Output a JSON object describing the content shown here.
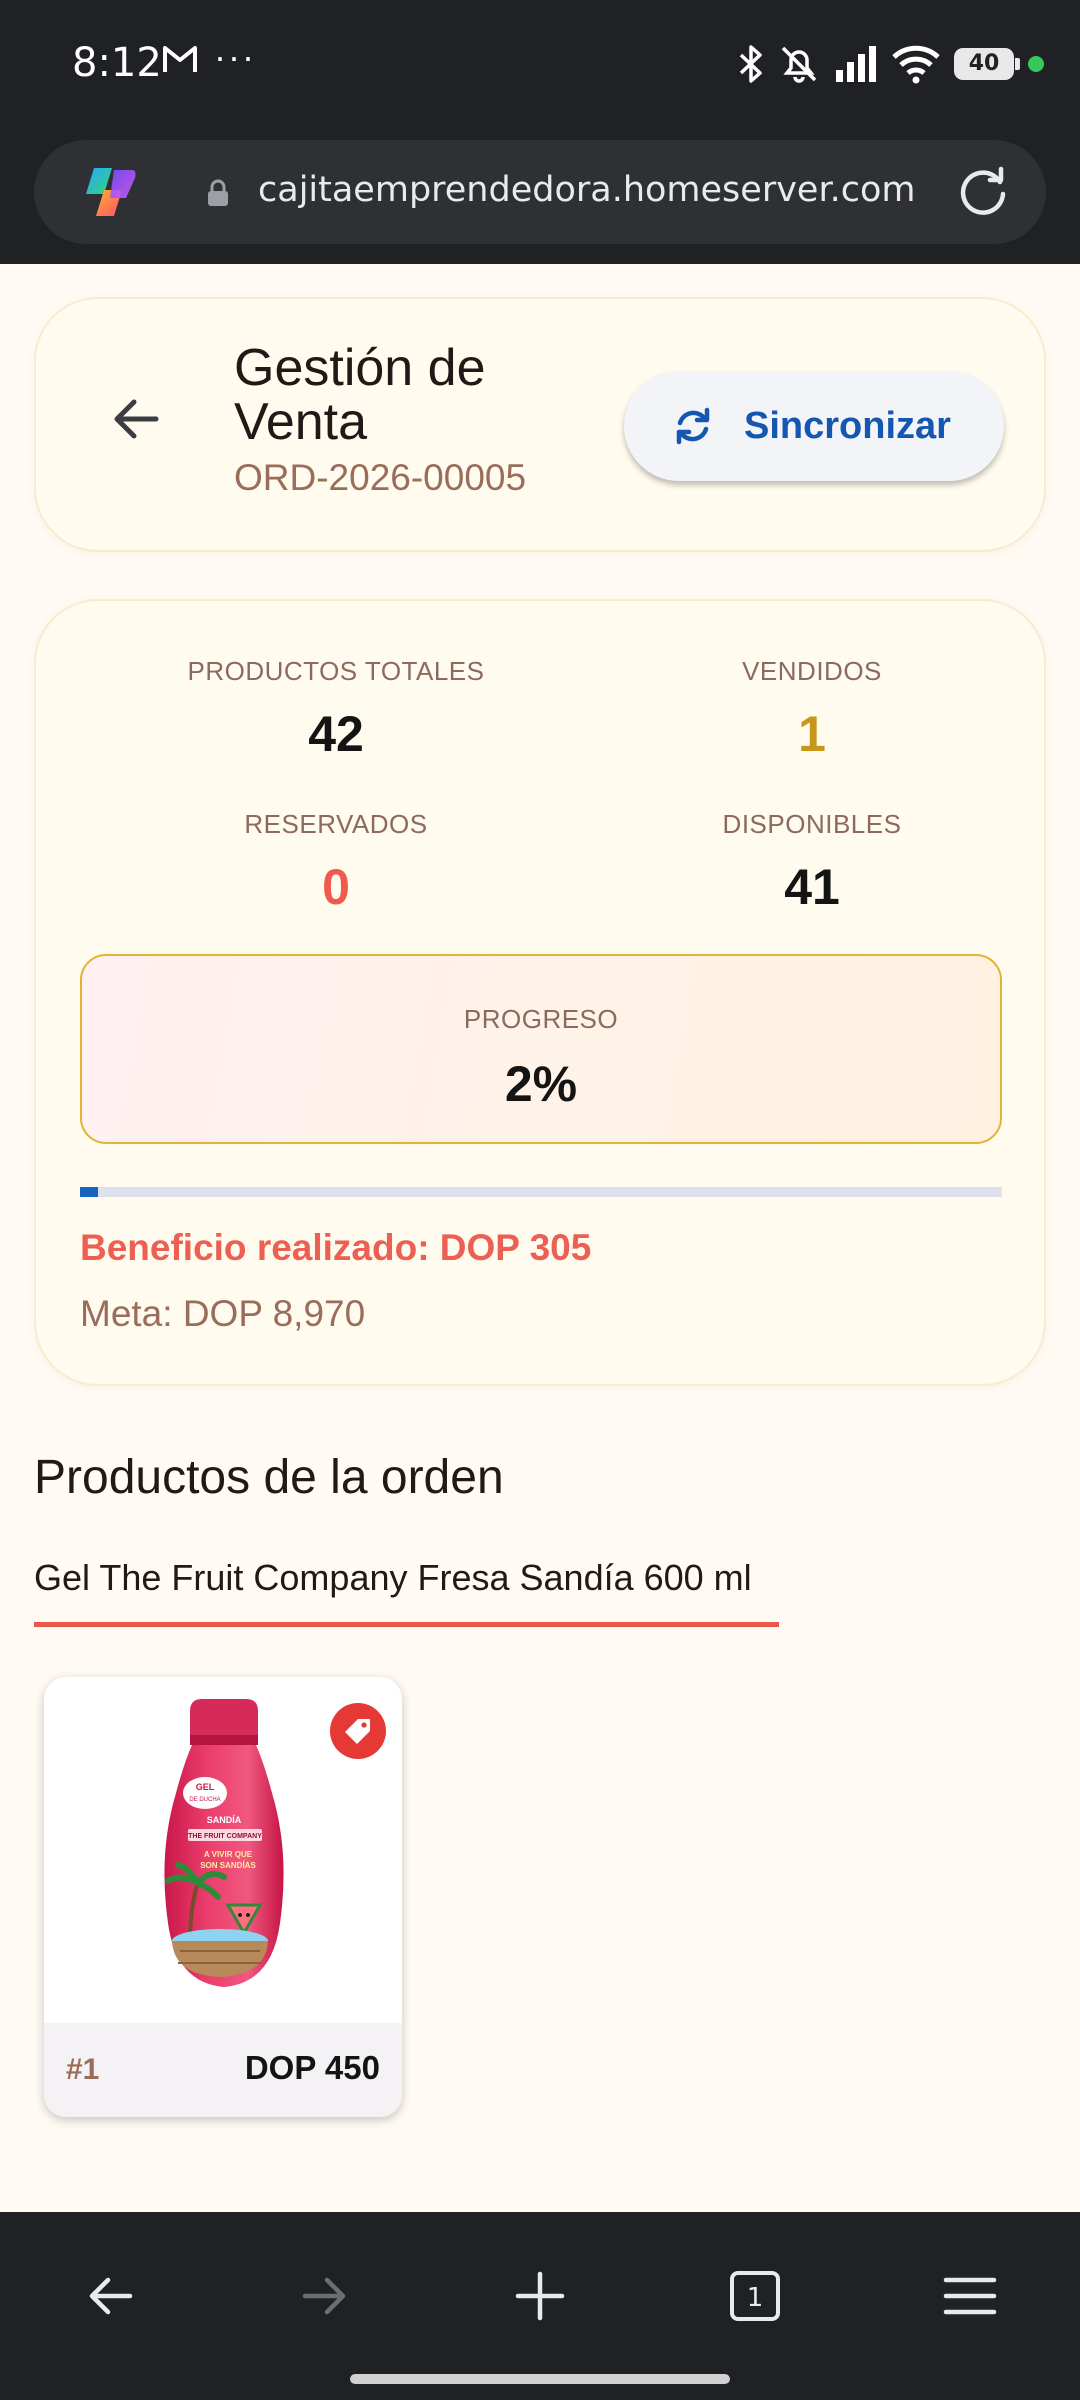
{
  "status_bar": {
    "time": "8:12",
    "more": "···",
    "battery": "40",
    "icons": [
      "gmail-icon",
      "bluetooth-icon",
      "bell-off-icon",
      "signal-icon",
      "wifi-icon",
      "battery-icon"
    ]
  },
  "browser": {
    "url": "cajitaemprendedora.homeserver.com",
    "tab_count": "1"
  },
  "header": {
    "title": "Gestión de Venta",
    "order_code": "ORD-2026-00005",
    "sync_label": "Sincronizar"
  },
  "stats": {
    "total_label": "PRODUCTOS TOTALES",
    "total_value": "42",
    "sold_label": "VENDIDOS",
    "sold_value": "1",
    "reserved_label": "RESERVADOS",
    "reserved_value": "0",
    "available_label": "DISPONIBLES",
    "available_value": "41",
    "progress_label": "PROGRESO",
    "progress_value": "2%",
    "progress_fraction": 0.02,
    "profit_text": "Beneficio realizado: DOP 305",
    "goal_text": "Meta: DOP 8,970"
  },
  "products": {
    "section_title": "Productos de la orden",
    "tab_label": "Gel The Fruit Company Fresa Sandía 600 ml",
    "items": [
      {
        "number": "#1",
        "price": "DOP 450",
        "image_text": {
          "line1": "GEL",
          "line2": "DE DUCHA",
          "line3": "SANDÍA",
          "line4": "THE FRUIT COMPANY",
          "line5": "A VIVIR QUE",
          "line6": "SON SANDÍAS"
        }
      }
    ]
  },
  "colors": {
    "accent_blue": "#1557b0",
    "sold_gold": "#c8961b",
    "reserved_red": "#f05a4f",
    "profit_red": "#ec5f52",
    "muted_brown": "#9a6d5a",
    "card_bg": "#fffbee"
  }
}
